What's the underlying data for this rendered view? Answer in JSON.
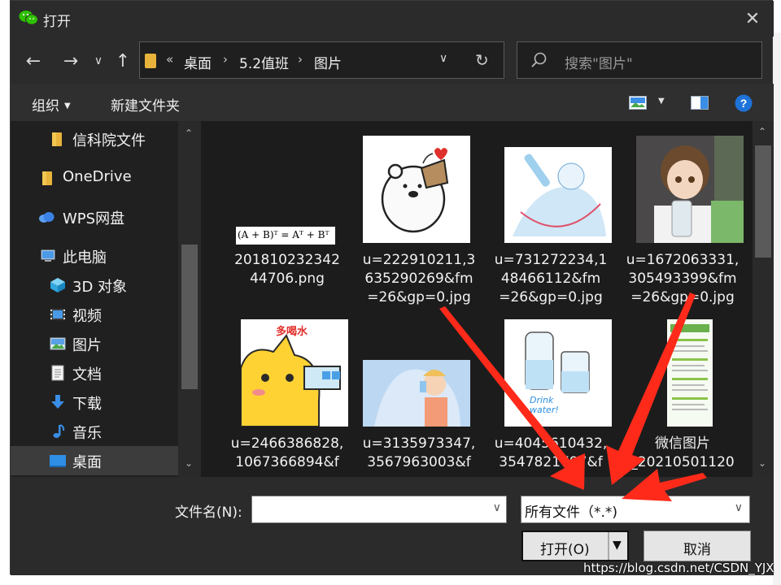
{
  "window": {
    "title": "打开",
    "app_icon": "wechat-icon",
    "close_icon": "close-icon"
  },
  "nav": {
    "back_icon": "back-arrow-icon",
    "forward_icon": "forward-arrow-icon",
    "recent_icon": "chevron-down-icon",
    "up_icon": "up-arrow-icon",
    "breadcrumb_overflow": "«",
    "breadcrumbs": [
      "桌面",
      "5.2值班",
      "图片"
    ],
    "search_placeholder": "搜索\"图片\""
  },
  "toolbar": {
    "organize_label": "组织",
    "new_folder_label": "新建文件夹"
  },
  "sidebar": {
    "items": [
      {
        "label": "信科院文件",
        "icon": "folder-icon",
        "selected": false
      },
      {
        "label": "OneDrive",
        "icon": "folder-icon",
        "selected": false
      },
      {
        "label": "WPS网盘",
        "icon": "cloud-icon",
        "selected": false
      },
      {
        "label": "此电脑",
        "icon": "computer-icon",
        "selected": false
      },
      {
        "label": "3D 对象",
        "icon": "cube-icon",
        "selected": false
      },
      {
        "label": "视频",
        "icon": "video-icon",
        "selected": false
      },
      {
        "label": "图片",
        "icon": "pictures-icon",
        "selected": false
      },
      {
        "label": "文档",
        "icon": "document-icon",
        "selected": false
      },
      {
        "label": "下载",
        "icon": "download-icon",
        "selected": false
      },
      {
        "label": "音乐",
        "icon": "music-icon",
        "selected": false
      },
      {
        "label": "桌面",
        "icon": "desktop-icon",
        "selected": true
      }
    ]
  },
  "files": {
    "items": [
      {
        "name": "20181023234244706.png",
        "lines": [
          "201810232342",
          "44706.png"
        ],
        "formula": "(A + B)ᵀ = Aᵀ + Bᵀ"
      },
      {
        "name": "u=222910211,3635290269&fm=26&gp=0.jpg",
        "lines": [
          "u=222910211,3",
          "635290269&fm",
          "=26&gp=0.jpg"
        ]
      },
      {
        "name": "u=731272234,148466112&fm=26&gp=0.jpg",
        "lines": [
          "u=731272234,1",
          "48466112&fm",
          "=26&gp=0.jpg"
        ]
      },
      {
        "name": "u=1672063331,305493399&fm=26&gp=0.jpg",
        "lines": [
          "u=1672063331,",
          "305493399&fm",
          "=26&gp=0.jpg"
        ]
      },
      {
        "name": "u=2466386828,1067366894&f",
        "lines": [
          "u=2466386828,",
          "1067366894&f"
        ],
        "caption": "多喝水"
      },
      {
        "name": "u=3135973347,3567963003&f",
        "lines": [
          "u=3135973347,",
          "3567963003&f"
        ]
      },
      {
        "name": "u=4045610432,3547821797&f",
        "lines": [
          "u=4045610432,",
          "3547821797&f"
        ],
        "caption": "Drink water!"
      },
      {
        "name": "微信图片_20210501120",
        "lines": [
          "微信图片",
          "_20210501120"
        ]
      }
    ]
  },
  "footer": {
    "filename_label": "文件名(N):",
    "filename_value": "",
    "filetype_value": "所有文件（*.*)",
    "open_label": "打开(O)",
    "cancel_label": "取消"
  },
  "watermark": "https://blog.csdn.net/CSDN_YJX",
  "colors": {
    "dialog_bg": "#2b2b2b",
    "panel_bg": "#1c1c1c",
    "arrow": "#ff2a1a",
    "folder": "#e8b33b",
    "help": "#1e73d8"
  }
}
